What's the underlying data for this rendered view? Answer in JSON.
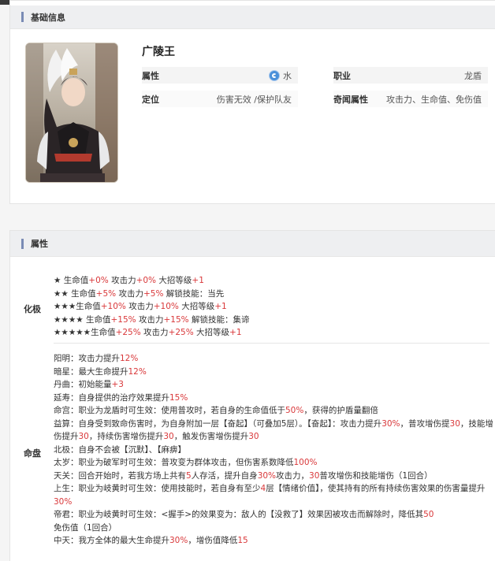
{
  "basic": {
    "header": "基础信息",
    "name": "广陵王",
    "attr_label": "属性",
    "attr_value": "水",
    "attr_icon": "water-icon",
    "job_label": "职业",
    "job_value": "龙盾",
    "role_label": "定位",
    "role_value": "伤害无效 /保护队友",
    "qiwen_label": "奇闻属性",
    "qiwen_value": "攻击力、生命值、免伤值"
  },
  "attrs": {
    "header": "属性",
    "huaji_label": "化极",
    "mingpan_label": "命盘",
    "huaji": [
      [
        {
          "t": "★ 生命值"
        },
        {
          "t": "+0%",
          "r": 1
        },
        {
          "t": " 攻击力"
        },
        {
          "t": "+0%",
          "r": 1
        },
        {
          "t": " 大招等级"
        },
        {
          "t": "+1",
          "r": 1
        }
      ],
      [
        {
          "t": "★★ 生命值"
        },
        {
          "t": "+5%",
          "r": 1
        },
        {
          "t": " 攻击力"
        },
        {
          "t": "+5%",
          "r": 1
        },
        {
          "t": " 解锁技能：当先"
        }
      ],
      [
        {
          "t": "★★★生命值"
        },
        {
          "t": "+10%",
          "r": 1
        },
        {
          "t": " 攻击力"
        },
        {
          "t": "+10%",
          "r": 1
        },
        {
          "t": " 大招等级"
        },
        {
          "t": "+1",
          "r": 1
        }
      ],
      [
        {
          "t": "★★★★ 生命值"
        },
        {
          "t": "+15%",
          "r": 1
        },
        {
          "t": " 攻击力"
        },
        {
          "t": "+15%",
          "r": 1
        },
        {
          "t": " 解锁技能：集谛"
        }
      ],
      [
        {
          "t": "★★★★★生命值"
        },
        {
          "t": "+25%",
          "r": 1
        },
        {
          "t": " 攻击力"
        },
        {
          "t": "+25%",
          "r": 1
        },
        {
          "t": " 大招等级"
        },
        {
          "t": "+1",
          "r": 1
        }
      ]
    ],
    "mingpan": [
      [
        {
          "t": "阳明：攻击力提升"
        },
        {
          "t": "12%",
          "r": 1
        }
      ],
      [
        {
          "t": "暗星：最大生命提升"
        },
        {
          "t": "12%",
          "r": 1
        }
      ],
      [
        {
          "t": "丹曲：初始能量"
        },
        {
          "t": "+3",
          "r": 1
        }
      ],
      [
        {
          "t": "延寿：自身提供的治疗效果提升"
        },
        {
          "t": "15%",
          "r": 1
        }
      ],
      [
        {
          "t": "命宫：职业为龙盾时可生效：使用普攻时，若自身的生命值低于"
        },
        {
          "t": "50%",
          "r": 1
        },
        {
          "t": "，获得的护盾量翻倍"
        }
      ],
      [
        {
          "t": "益算：自身受到致命伤害时，为自身附加一层【奋起】（可叠加5层）。【奋起】：攻击力提升"
        },
        {
          "t": "30%",
          "r": 1
        },
        {
          "t": "，普攻增伤提"
        },
        {
          "t": "30",
          "r": 1
        },
        {
          "t": "，技能增伤提升"
        },
        {
          "t": "30",
          "r": 1
        },
        {
          "t": "，持续伤害增伤提升"
        },
        {
          "t": "30",
          "r": 1
        },
        {
          "t": "，触发伤害增伤提升"
        },
        {
          "t": "30",
          "r": 1
        }
      ],
      [
        {
          "t": "北极：自身不会被【沉默】、【麻痹】"
        }
      ],
      [
        {
          "t": "太岁：职业为破军时可生效：普攻变为群体攻击，但伤害系数降低"
        },
        {
          "t": "100%",
          "r": 1
        }
      ],
      [
        {
          "t": "天关：回合开始时，若我方场上共有"
        },
        {
          "t": "5",
          "r": 1
        },
        {
          "t": "人存活，提升自身"
        },
        {
          "t": "30%",
          "r": 1
        },
        {
          "t": "攻击力，"
        },
        {
          "t": "30",
          "r": 1
        },
        {
          "t": "普攻增伤和技能增伤（1回合）"
        }
      ],
      [
        {
          "t": "上生：职业为岐黄时可生效：使用技能时，若自身有至少"
        },
        {
          "t": "4",
          "r": 1
        },
        {
          "t": "层【情绪价值】，使其持有的所有持续伤害效果的伤害量提升"
        },
        {
          "t": "30%",
          "r": 1
        }
      ],
      [
        {
          "t": "帝君：职业为岐黄时可生效：<握手>的效果变为：敌人的【没救了】效果因被攻击而解除时，降低其"
        },
        {
          "t": "50",
          "r": 1
        },
        {
          "t": "免伤值（1回合）"
        }
      ],
      [
        {
          "t": "中天：我方全体的最大生命提升"
        },
        {
          "t": "30%",
          "r": 1
        },
        {
          "t": "，增伤值降低"
        },
        {
          "t": "15",
          "r": 1
        }
      ]
    ]
  }
}
